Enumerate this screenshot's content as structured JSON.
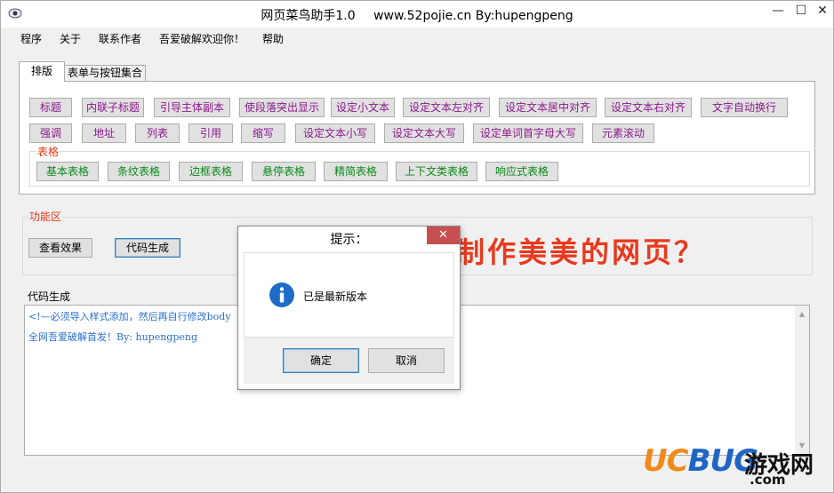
{
  "window": {
    "title_main": "网页菜鸟助手1.0",
    "title_site": "www.52pojie.cn By:hupengpeng",
    "minimize_glyph": "—",
    "maximize_glyph": "☐",
    "close_glyph": "✕"
  },
  "menu": [
    "程序",
    "关于",
    "联系作者",
    "吾爱破解欢迎你！",
    "帮助"
  ],
  "tabs": [
    {
      "label": "排版",
      "active": true
    },
    {
      "label": "表单与按钮集合",
      "active": false
    }
  ],
  "layout_buttons_row1": [
    "标题",
    "内联子标题",
    "引导主体副本",
    "使段落突出显示",
    "设定小文本",
    "设定文本左对齐",
    "设定文本居中对齐",
    "设定文本右对齐",
    "文字自动换行"
  ],
  "layout_buttons_row2": [
    "强调",
    "地址",
    "列表",
    "引用",
    "缩写",
    "设定文本小写",
    "设定文本大写",
    "设定单词首字母大写",
    "元素滚动"
  ],
  "table_group": {
    "label": "表格",
    "buttons": [
      "基本表格",
      "条纹表格",
      "边框表格",
      "悬停表格",
      "精简表格",
      "上下文类表格",
      "响应式表格"
    ]
  },
  "function_area": {
    "label": "功能区",
    "preview_button": "查看效果",
    "generate_button": "代码生成",
    "slogan": "制作美美的网页？"
  },
  "code_area": {
    "label": "代码生成",
    "lines": [
      "<!—必须导入样式添加，然后再自行修改body",
      "全网吾爱破解首发！By: hupengpeng"
    ]
  },
  "dialog": {
    "title": "提示：",
    "close_glyph": "✕",
    "message": "已是最新版本",
    "ok_label": "确定",
    "cancel_label": "取消",
    "icon": "info-icon"
  },
  "watermark": {
    "ucbug_u": "U",
    "ucbug_c": "C",
    "ucbug_b": "BUG",
    "cn_text": "游戏网",
    "com_text": ".com"
  },
  "colors": {
    "button_text_purple": "#8b1a8b",
    "button_text_green": "#0b8a1a",
    "label_red": "#e03a1a",
    "slogan_red": "#e8391e",
    "code_blue": "#2a6fcd",
    "dialog_close_bg": "#c74f4f",
    "info_icon_blue": "#1e6cc8"
  }
}
